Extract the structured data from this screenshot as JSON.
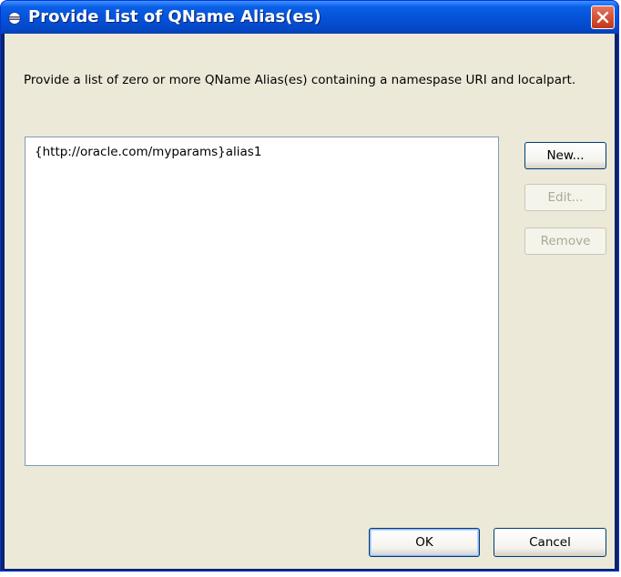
{
  "window": {
    "title": "Provide List of QName Alias(es)",
    "app_icon": "eclipse-icon",
    "close_icon": "close-icon"
  },
  "dialog": {
    "description": "Provide a list of zero or more QName Alias(es) containing a namespase URI and localpart.",
    "list_items": [
      "{http://oracle.com/myparams}alias1"
    ]
  },
  "buttons": {
    "new": "New...",
    "edit": "Edit...",
    "remove": "Remove",
    "ok": "OK",
    "cancel": "Cancel"
  },
  "colors": {
    "titlebar": "#0553d8",
    "dialog_bg": "#ece9d8",
    "close_button": "#d8553a"
  }
}
